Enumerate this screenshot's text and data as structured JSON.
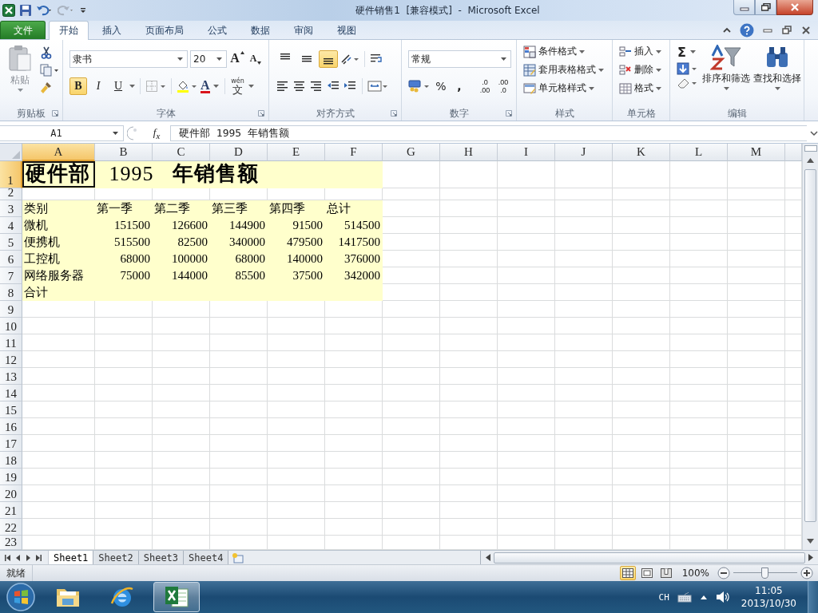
{
  "title_bar": {
    "title": "硬件销售1  [兼容模式]  -  Microsoft Excel"
  },
  "tabs": [
    {
      "label": "文件",
      "kind": "file",
      "selected": false
    },
    {
      "label": "开始",
      "kind": "tab",
      "selected": true
    },
    {
      "label": "插入",
      "kind": "tab",
      "selected": false
    },
    {
      "label": "页面布局",
      "kind": "tab",
      "selected": false
    },
    {
      "label": "公式",
      "kind": "tab",
      "selected": false
    },
    {
      "label": "数据",
      "kind": "tab",
      "selected": false
    },
    {
      "label": "审阅",
      "kind": "tab",
      "selected": false
    },
    {
      "label": "视图",
      "kind": "tab",
      "selected": false
    }
  ],
  "ribbon": {
    "clipboard": {
      "paste": "粘贴",
      "label": "剪贴板"
    },
    "font": {
      "name": "隶书",
      "size": "20",
      "grow": "A",
      "shrink": "A",
      "styles": [
        {
          "label": "B",
          "on": true
        },
        {
          "label": "I",
          "on": false
        },
        {
          "label": "U",
          "on": false
        }
      ],
      "color_letter": "A",
      "phonetic_top": "wén",
      "phonetic_glyph": "文",
      "label": "字体"
    },
    "alignment": {
      "vertical": [
        {
          "selected": false
        },
        {
          "selected": false
        },
        {
          "selected": true
        }
      ],
      "label": "对齐方式"
    },
    "number": {
      "format": "常规",
      "percent": "%",
      "comma": ",",
      "increase_decimal": [
        ".0",
        ".00"
      ],
      "decrease_decimal": [
        ".00",
        ".0"
      ],
      "label": "数字"
    },
    "styles": {
      "items": [
        "条件格式",
        "套用表格格式",
        "单元格样式"
      ],
      "label": "样式"
    },
    "cells": {
      "items": [
        "插入",
        "删除",
        "格式"
      ],
      "label": "单元格"
    },
    "editing": {
      "sum": "Σ",
      "sort": "排序和筛选",
      "find": "查找和选择",
      "label": "编辑"
    }
  },
  "formula_bar": {
    "name_box": "A1",
    "fx": "f$_{x}$",
    "content": "硬件部 1995 年销售额"
  },
  "sheet": {
    "columns": [
      {
        "label": "A",
        "selected": true
      },
      {
        "label": "B",
        "selected": false
      },
      {
        "label": "C",
        "selected": false
      },
      {
        "label": "D",
        "selected": false
      },
      {
        "label": "E",
        "selected": false
      },
      {
        "label": "F",
        "selected": false
      },
      {
        "label": "G",
        "selected": false
      },
      {
        "label": "H",
        "selected": false
      },
      {
        "label": "I",
        "selected": false
      },
      {
        "label": "J",
        "selected": false
      },
      {
        "label": "K",
        "selected": false
      },
      {
        "label": "L",
        "selected": false
      },
      {
        "label": "M",
        "selected": false
      }
    ],
    "rows": [
      {
        "number": "1",
        "selected": true,
        "highlighted": true,
        "kind": "title",
        "label": "**硬件部** 1995 **年销售额**"
      },
      {
        "number": "2",
        "selected": false,
        "highlighted": false
      },
      {
        "number": "3",
        "selected": false,
        "highlighted": true,
        "kind": "header",
        "label": "类别",
        "values": [
          "第一季",
          "第二季",
          "第三季",
          "第四季",
          "总计"
        ]
      },
      {
        "number": "4",
        "selected": false,
        "highlighted": true,
        "kind": "data",
        "label": "微机",
        "values": [
          "151500",
          "126600",
          "144900",
          "91500",
          "514500"
        ]
      },
      {
        "number": "5",
        "selected": false,
        "highlighted": true,
        "kind": "data",
        "label": "便携机",
        "values": [
          "515500",
          "82500",
          "340000",
          "479500",
          "1417500"
        ]
      },
      {
        "number": "6",
        "selected": false,
        "highlighted": true,
        "kind": "data",
        "label": "工控机",
        "values": [
          "68000",
          "100000",
          "68000",
          "140000",
          "376000"
        ]
      },
      {
        "number": "7",
        "selected": false,
        "highlighted": true,
        "kind": "data",
        "label": "网络服务器",
        "values": [
          "75000",
          "144000",
          "85500",
          "37500",
          "342000"
        ]
      },
      {
        "number": "8",
        "selected": false,
        "highlighted": true,
        "kind": "data",
        "label": "合计"
      },
      {
        "number": "9",
        "selected": false,
        "highlighted": false
      },
      {
        "number": "10",
        "selected": false,
        "highlighted": false
      },
      {
        "number": "11",
        "selected": false,
        "highlighted": false
      },
      {
        "number": "12",
        "selected": false,
        "highlighted": false
      },
      {
        "number": "13",
        "selected": false,
        "highlighted": false
      },
      {
        "number": "14",
        "selected": false,
        "highlighted": false
      },
      {
        "number": "15",
        "selected": false,
        "highlighted": false
      },
      {
        "number": "16",
        "selected": false,
        "highlighted": false
      },
      {
        "number": "17",
        "selected": false,
        "highlighted": false
      },
      {
        "number": "18",
        "selected": false,
        "highlighted": false
      },
      {
        "number": "19",
        "selected": false,
        "highlighted": false
      },
      {
        "number": "20",
        "selected": false,
        "highlighted": false
      },
      {
        "number": "21",
        "selected": false,
        "highlighted": false
      },
      {
        "number": "22",
        "selected": false,
        "highlighted": false
      },
      {
        "number": "23",
        "selected": false,
        "highlighted": false
      }
    ]
  },
  "sheet_tabs": [
    {
      "label": "Sheet1",
      "selected": true
    },
    {
      "label": "Sheet2",
      "selected": false
    },
    {
      "label": "Sheet3",
      "selected": false
    },
    {
      "label": "Sheet4",
      "selected": false
    }
  ],
  "status_bar": {
    "text": "就绪",
    "views": [
      {
        "selected": true
      },
      {
        "selected": false
      },
      {
        "selected": false
      }
    ],
    "zoom": "100%",
    "zoom_slider": {
      "level": 0.5
    }
  },
  "taskbar": {
    "apps": [
      {
        "kind": "folder",
        "active": false
      },
      {
        "kind": "browser",
        "active": false
      },
      {
        "kind": "spreadsheet",
        "active": true
      }
    ],
    "input": "CH",
    "time": "11:05",
    "date": "2013/10/30"
  }
}
